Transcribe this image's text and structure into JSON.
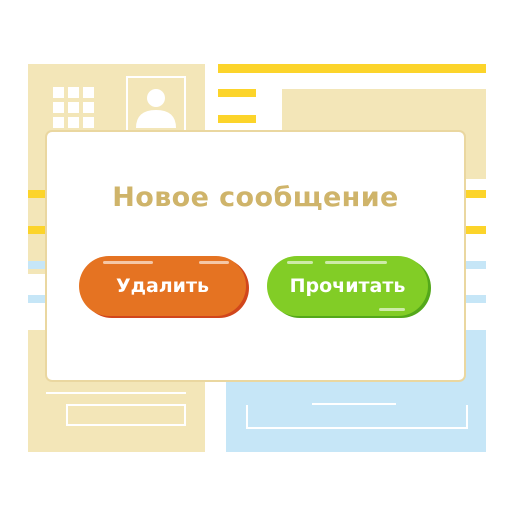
{
  "dialog": {
    "title": "Новое сообщение",
    "delete_label": "Удалить",
    "read_label": "Прочитать"
  },
  "colors": {
    "title": "#cfb46a",
    "delete_button": "#e57322",
    "read_button": "#82cd26",
    "panel_beige": "#f3e6b8",
    "panel_blue": "#c6e6f7",
    "accent_yellow": "#fcd42a"
  },
  "icons": [
    "apps-grid-icon",
    "user-avatar-icon"
  ]
}
